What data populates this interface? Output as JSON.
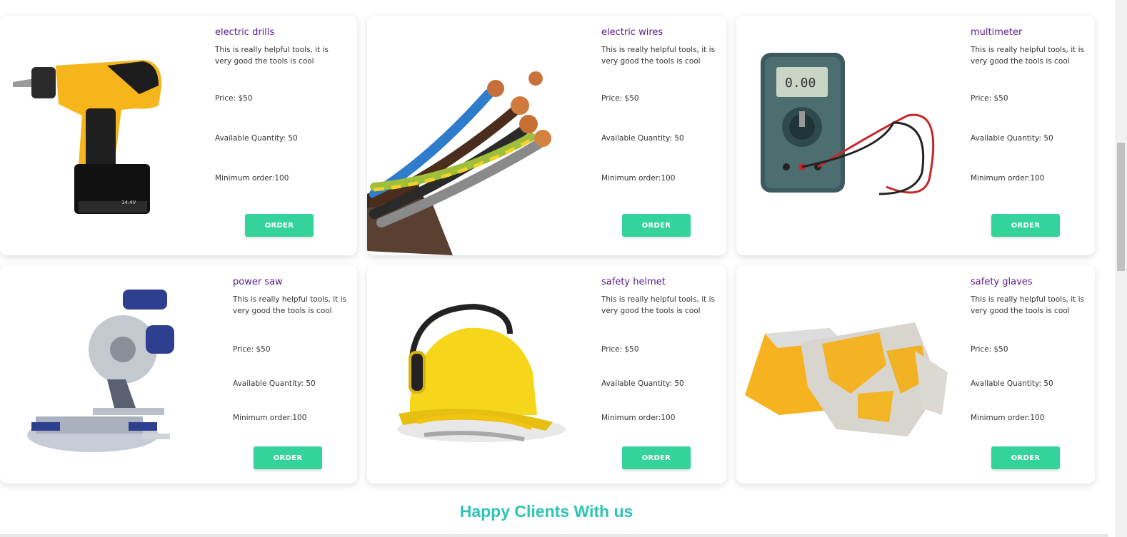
{
  "products": [
    {
      "name": "electric drills",
      "description": "This is really helpful tools, it is very good the tools is cool",
      "price": "Price: $50",
      "quantity": "Available Quantity: 50",
      "min_order": "Minimum order:100",
      "button": "ORDER",
      "icon": "drill-image"
    },
    {
      "name": "electric wires",
      "description": "This is really helpful tools, it is very good the tools is cool",
      "price": "Price: $50",
      "quantity": "Available Quantity: 50",
      "min_order": "Minimum order:100",
      "button": "ORDER",
      "icon": "wires-image"
    },
    {
      "name": "multimeter",
      "description": "This is really helpful tools, it is very good the tools is cool",
      "price": "Price: $50",
      "quantity": "Available Quantity: 50",
      "min_order": "Minimum order:100",
      "button": "ORDER",
      "icon": "multimeter-image"
    },
    {
      "name": "power saw",
      "description": "This is really helpful tools, it is very good the tools is cool",
      "price": "Price: $50",
      "quantity": "Available Quantity: 50",
      "min_order": "Minimum order:100",
      "button": "ORDER",
      "icon": "saw-image"
    },
    {
      "name": "safety helmet",
      "description": "This is really helpful tools, it is very good the tools is cool",
      "price": "Price: $50",
      "quantity": "Available Quantity: 50",
      "min_order": "Minimum order:100",
      "button": "ORDER",
      "icon": "helmet-image"
    },
    {
      "name": "safety glaves",
      "description": "This is really helpful tools, it is very good the tools is cool",
      "price": "Price: $50",
      "quantity": "Available Quantity: 50",
      "min_order": "Minimum order:100",
      "button": "ORDER",
      "icon": "gloves-image"
    }
  ],
  "section_heading": "Happy Clients With us",
  "colors": {
    "accent_button": "#34d399",
    "title_purple": "#5b1a8c",
    "heading_teal": "#2ec4b6"
  }
}
